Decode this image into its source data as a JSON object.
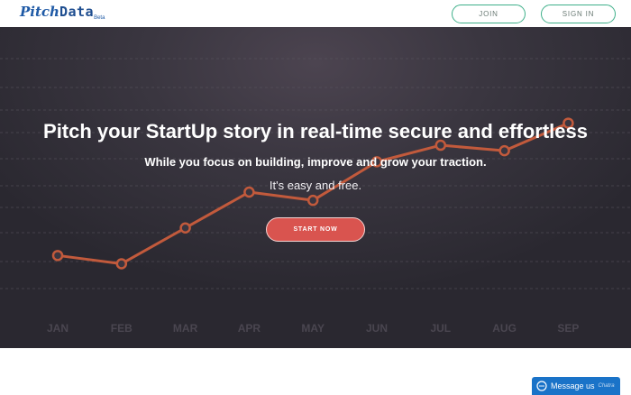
{
  "header": {
    "logo_pitch": "Pitch",
    "logo_data": "Data",
    "logo_beta": "Beta",
    "join_label": "JOIN",
    "signin_label": "SIGN IN"
  },
  "hero": {
    "title": "Pitch your StartUp story in real-time secure and effortless",
    "subtitle": "While you focus on building, improve and grow your traction.",
    "note": "It's easy and free.",
    "cta_label": "START NOW"
  },
  "chart_data": {
    "type": "line",
    "categories": [
      "JAN",
      "FEB",
      "MAR",
      "APR",
      "MAY",
      "JUN",
      "JUL",
      "AUG",
      "SEP"
    ],
    "values": [
      12,
      9,
      22,
      35,
      32,
      46,
      52,
      50,
      60
    ],
    "ylim": [
      0,
      70
    ],
    "grid": true,
    "line_color": "#c25a3c"
  },
  "chat": {
    "label": "Message us",
    "brand": "Chatra"
  },
  "colors": {
    "brand_blue": "#1f5aa6",
    "accent_green": "#3fb08a",
    "cta_red": "#d9544f",
    "chat_blue": "#1a73c8"
  }
}
